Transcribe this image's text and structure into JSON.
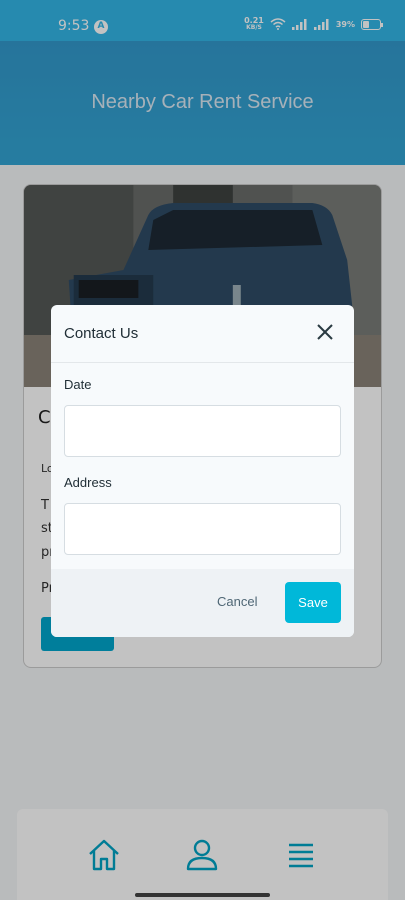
{
  "status_bar": {
    "time": "9:53",
    "network_speed_value": "0.21",
    "network_speed_unit": "KB/S",
    "battery_percent": "39%"
  },
  "header": {
    "title": "Nearby Car Rent Service"
  },
  "card": {
    "heading_partial": "C",
    "line1_partial": "Lo",
    "line2_partial": "T",
    "line3_partial": "st",
    "line4_partial": "pr",
    "line5_partial": "Pr"
  },
  "modal": {
    "title": "Contact Us",
    "date_label": "Date",
    "date_value": "",
    "address_label": "Address",
    "address_value": "",
    "cancel_label": "Cancel",
    "save_label": "Save"
  },
  "nav": {
    "items": [
      {
        "icon": "home-icon"
      },
      {
        "icon": "user-icon"
      },
      {
        "icon": "menu-icon"
      }
    ]
  },
  "colors": {
    "header": "#3399cc",
    "accent": "#00b8d9",
    "nav_icon": "#00a3c4"
  }
}
